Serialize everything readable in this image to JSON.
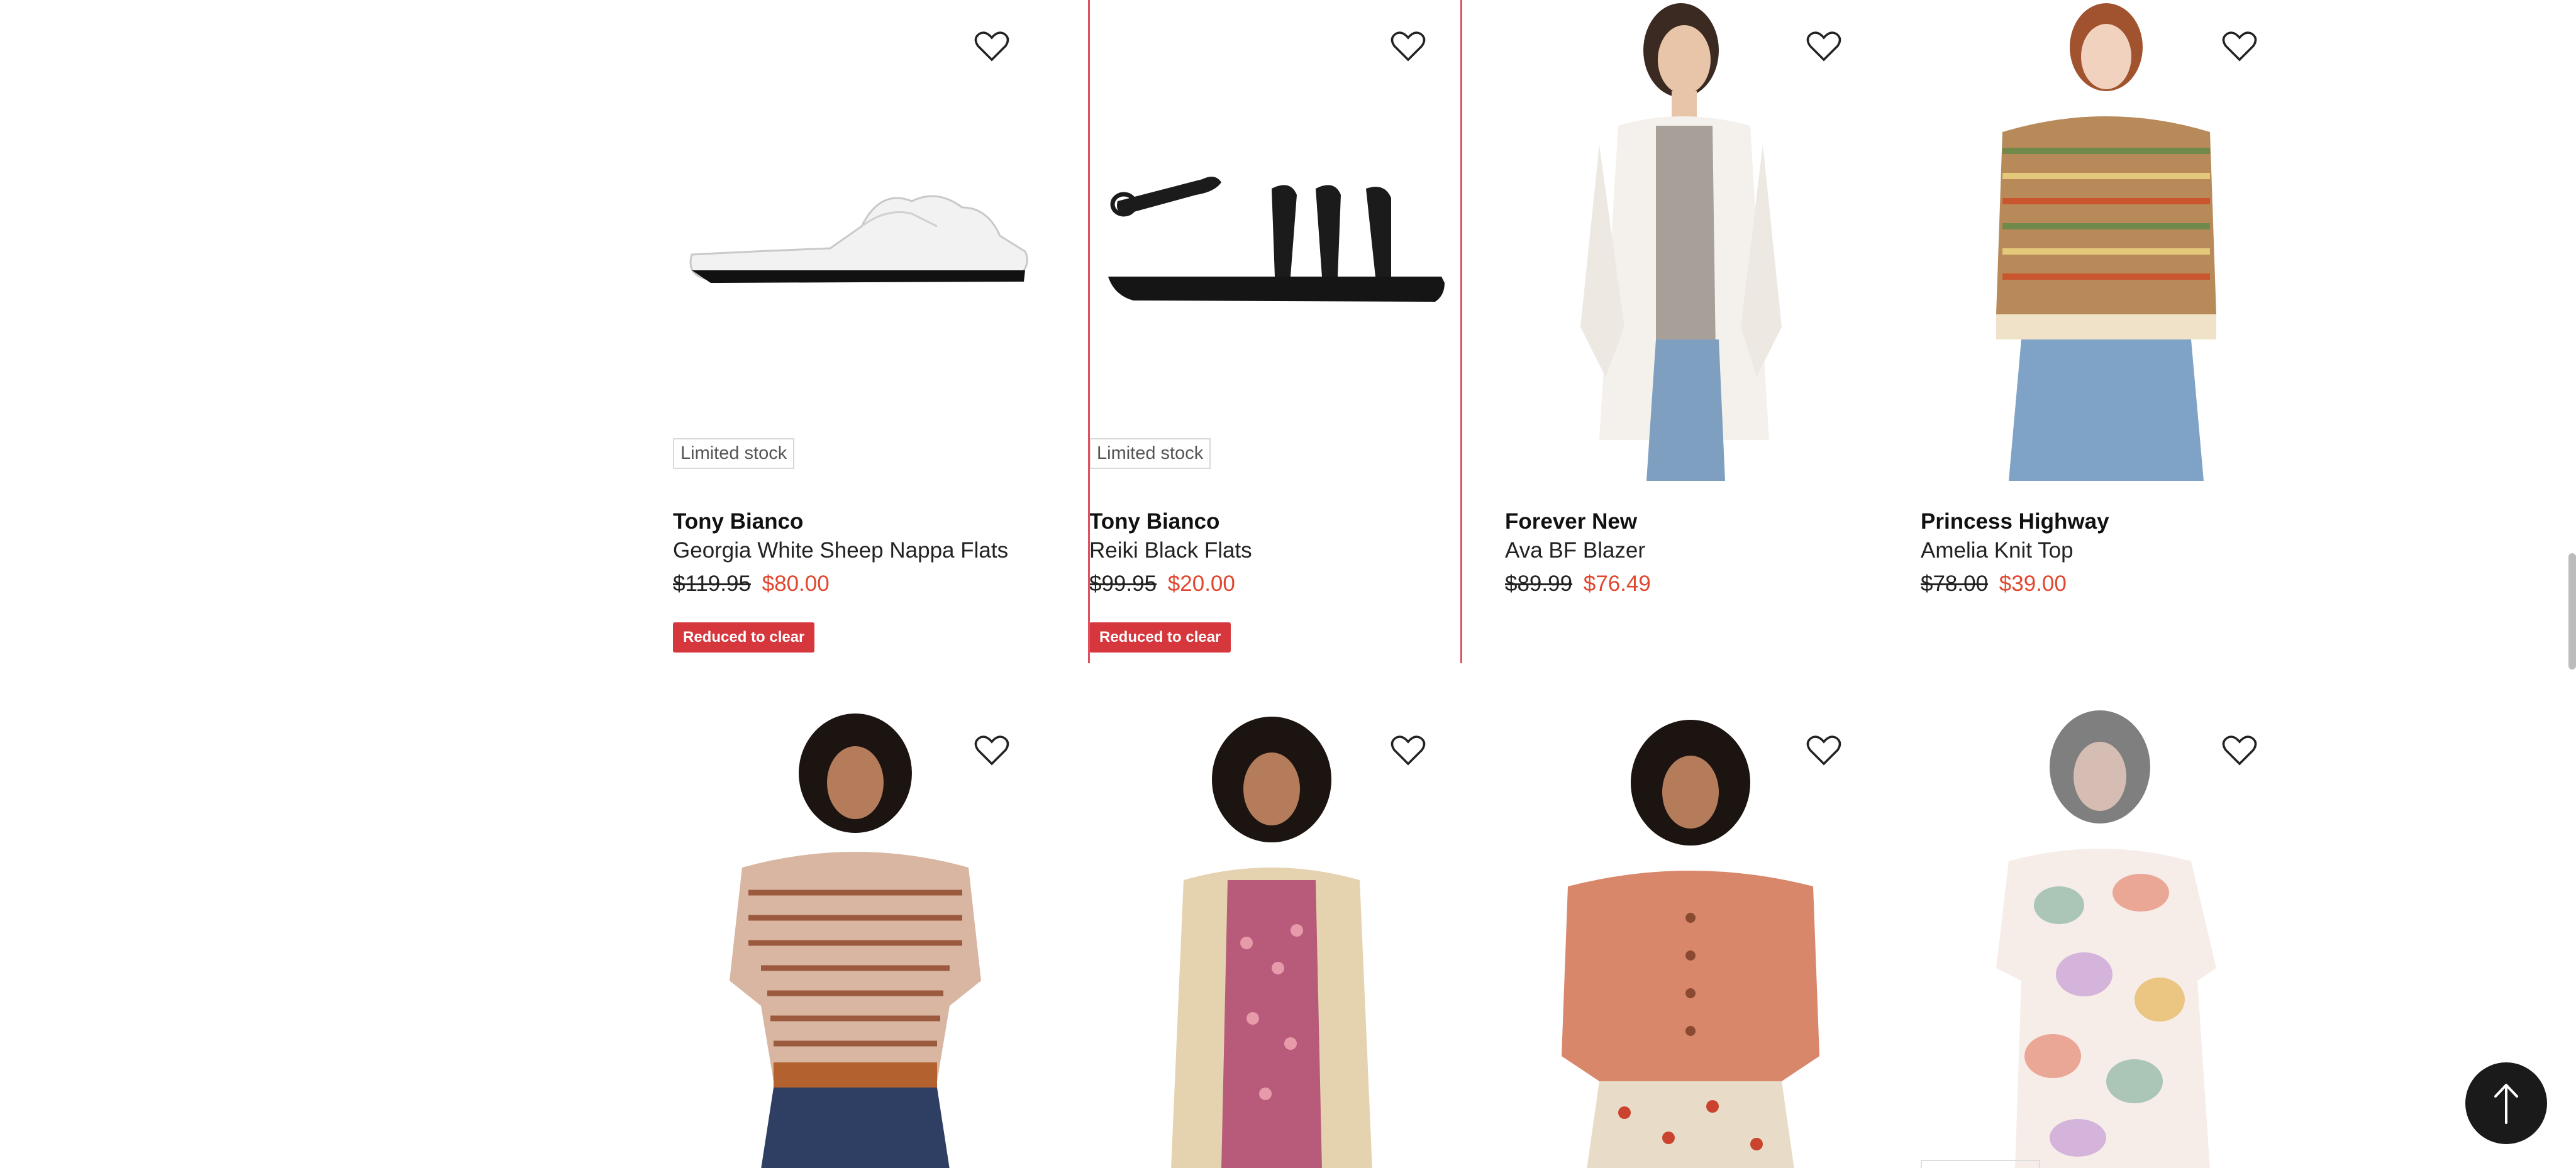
{
  "products_row1": [
    {
      "stock_label": "Limited stock",
      "brand": "Tony Bianco",
      "name": "Georgia White Sheep Nappa Flats",
      "was_price": "$119.95",
      "now_price": "$80.00",
      "badge": "Reduced to clear",
      "image": "white slide flat sandal"
    },
    {
      "stock_label": "Limited stock",
      "brand": "Tony Bianco",
      "name": "Reiki Black Flats",
      "was_price": "$99.95",
      "now_price": "$20.00",
      "badge": "Reduced to clear",
      "image": "black strappy flat sandal"
    },
    {
      "brand": "Forever New",
      "name": "Ava BF Blazer",
      "was_price": "$89.99",
      "now_price": "$76.49",
      "image": "model in white blazer"
    },
    {
      "brand": "Princess Highway",
      "name": "Amelia Knit Top",
      "was_price": "$78.00",
      "now_price": "$39.00",
      "image": "model in striped knit top"
    }
  ],
  "products_row2": [
    {
      "image": "model in striped knit tee"
    },
    {
      "image": "model in cardigan and floral dress"
    },
    {
      "image": "model in terracotta cardigan"
    },
    {
      "image": "model in floral print dress"
    }
  ],
  "icons": {
    "wishlist": "heart-outline-icon",
    "back_to_top": "arrow-up-icon"
  },
  "colors": {
    "sale_price": "#e0472e",
    "badge_bg": "#d6373d",
    "highlight_border": "#e05060",
    "back_to_top_bg": "#1a1a1a"
  }
}
